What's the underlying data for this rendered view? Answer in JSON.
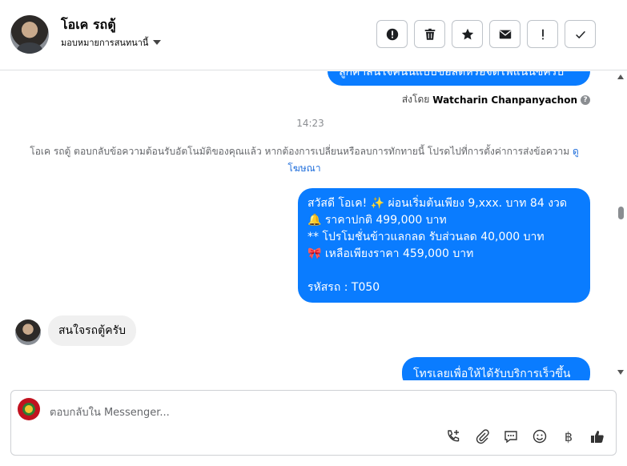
{
  "header": {
    "name": "โอเค รถตู้",
    "assign_label": "มอบหมายการสนทนานี้",
    "toolbar": [
      {
        "name": "alert-button",
        "icon": "exclamation-circle-icon"
      },
      {
        "name": "delete-button",
        "icon": "trash-icon"
      },
      {
        "name": "star-button",
        "icon": "star-icon"
      },
      {
        "name": "mail-button",
        "icon": "envelope-icon"
      },
      {
        "name": "spam-button",
        "icon": "exclamation-icon"
      },
      {
        "name": "done-button",
        "icon": "check-icon"
      }
    ]
  },
  "messages": {
    "top_bubble_text": "ลูกค้าสนใจคันนี้แบบขอสดหรือจัดไฟแนนซ์ครับ",
    "sent_by_prefix": "ส่งโดย",
    "sent_by_name": "Watcharin Chanpanyachon",
    "time": "14:23",
    "auto_note": "โอเค รถตู้ ตอบกลับข้อความต้อนรับอัตโนมัติของคุณแล้ว หากต้องการเปลี่ยนหรือลบการทักทายนี้ โปรดไปที่การตั้งค่าการส่งข้อความ",
    "auto_note_link": "ดูโฆษณา",
    "main_bubble": {
      "line1": "สวัสดี โอเค! ✨  ผ่อนเริ่มต้นเพียง 9,xxx. บาท 84 งวด",
      "line2": "🔔 ราคาปกติ 499,000 บาท",
      "line3": "** โปรโมชั่นข้าวแลกลด รับส่วนลด 40,000 บาท",
      "line4": "🎀  เหลือเพียงราคา 459,000 บาท",
      "line5": "",
      "line6": " รหัสรถ : T050"
    },
    "incoming_text": "สนใจรถตู้ครับ",
    "bottom_bubble_text": "โทรเลยเพื่อให้ได้รับบริการเร็วขึ้น"
  },
  "composer": {
    "placeholder": "ตอบกลับใน Messenger...",
    "icons": [
      "phone-add-icon",
      "paperclip-icon",
      "comment-icon",
      "emoji-icon",
      "baht-icon",
      "thumbs-up-icon"
    ],
    "baht_symbol": "฿"
  },
  "colors": {
    "outgoing_bubble": "#0a7cff",
    "incoming_bubble": "#f0f0f0",
    "link": "#216fdb"
  }
}
